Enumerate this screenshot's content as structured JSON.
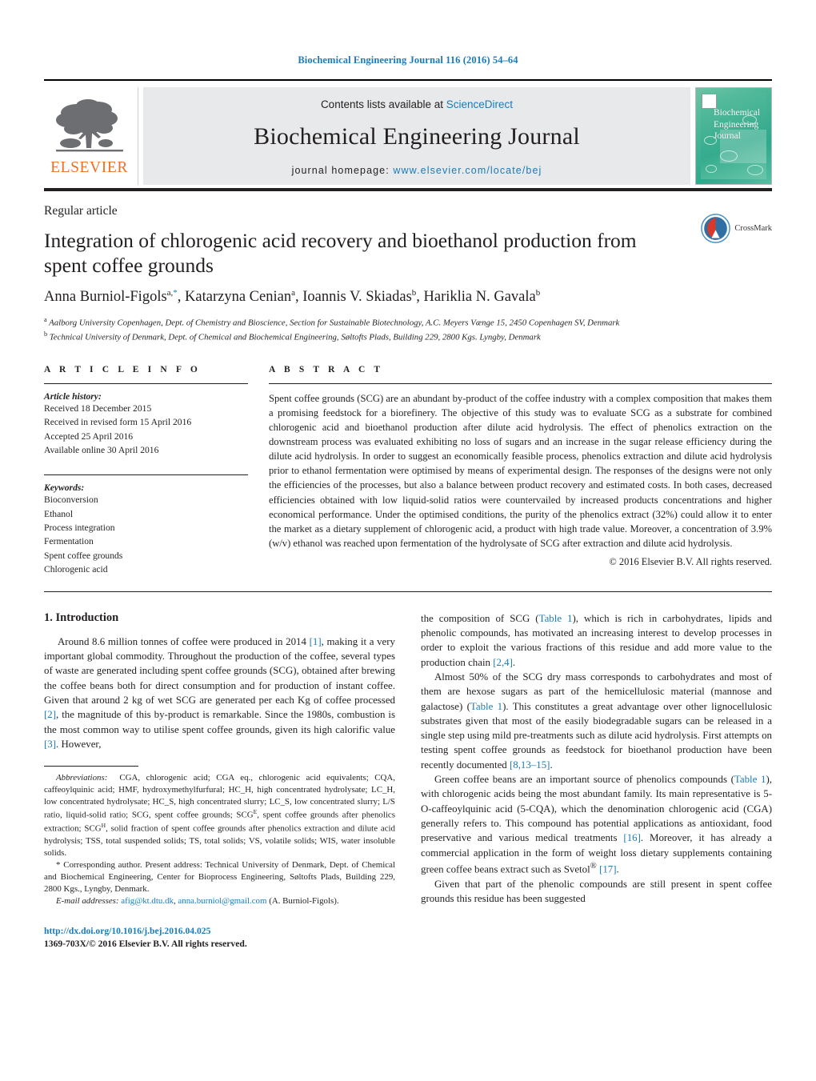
{
  "masthead": {
    "running_head": "Biochemical Engineering Journal 116 (2016) 54–64",
    "contents_prefix": "Contents lists available at ",
    "contents_link": "ScienceDirect",
    "journal_title": "Biochemical Engineering Journal",
    "homepage_prefix": "journal homepage: ",
    "homepage_url": "www.elsevier.com/locate/bej",
    "publisher_logo_text": "ELSEVIER",
    "cover_title_lines": [
      "Biochemical",
      "Engineering",
      "Journal"
    ],
    "link_color": "#1a7bb9",
    "publisher_color": "#ea7125"
  },
  "article": {
    "type": "Regular article",
    "title": "Integration of chlorogenic acid recovery and bioethanol production from spent coffee grounds",
    "crossmark_label": "CrossMark",
    "authors_html": "Anna Burniol-Figols<sup>a,<span class=\"star\">*</span></sup>, Katarzyna Cenian<sup>a</sup>, Ioannis V. Skiadas<sup>b</sup>, Hariklia N. Gavala<sup>b</sup>",
    "affiliations": [
      {
        "mark": "a",
        "text": "Aalborg University Copenhagen, Dept. of Chemistry and Bioscience, Section for Sustainable Biotechnology, A.C. Meyers Vænge 15, 2450 Copenhagen SV, Denmark"
      },
      {
        "mark": "b",
        "text": "Technical University of Denmark, Dept. of Chemical and Biochemical Engineering, Søltofts Plads, Building 229, 2800 Kgs. Lyngby, Denmark"
      }
    ]
  },
  "article_info": {
    "heading": "A R T I C L E   I N F O",
    "history_label": "Article history:",
    "history": [
      "Received 18 December 2015",
      "Received in revised form 15 April 2016",
      "Accepted 25 April 2016",
      "Available online 30 April 2016"
    ],
    "keywords_label": "Keywords:",
    "keywords": [
      "Bioconversion",
      "Ethanol",
      "Process integration",
      "Fermentation",
      "Spent coffee grounds",
      "Chlorogenic acid"
    ]
  },
  "abstract": {
    "heading": "A B S T R A C T",
    "text": "Spent coffee grounds (SCG) are an abundant by-product of the coffee industry with a complex composition that makes them a promising feedstock for a biorefinery. The objective of this study was to evaluate SCG as a substrate for combined chlorogenic acid and bioethanol production after dilute acid hydrolysis. The effect of phenolics extraction on the downstream process was evaluated exhibiting no loss of sugars and an increase in the sugar release efficiency during the dilute acid hydrolysis. In order to suggest an economically feasible process, phenolics extraction and dilute acid hydrolysis prior to ethanol fermentation were optimised by means of experimental design. The responses of the designs were not only the efficiencies of the processes, but also a balance between product recovery and estimated costs. In both cases, decreased efficiencies obtained with low liquid-solid ratios were countervailed by increased products concentrations and higher economical performance. Under the optimised conditions, the purity of the phenolics extract (32%) could allow it to enter the market as a dietary supplement of chlorogenic acid, a product with high trade value. Moreover, a concentration of 3.9% (w/v) ethanol was reached upon fermentation of the hydrolysate of SCG after extraction and dilute acid hydrolysis.",
    "copyright": "© 2016 Elsevier B.V. All rights reserved."
  },
  "introduction": {
    "heading": "1.  Introduction",
    "left_paragraphs": [
      "Around 8.6 million tonnes of coffee were produced in 2014 <span class=\"ref\">[1]</span>, making it a very important global commodity. Throughout the production of the coffee, several types of waste are generated including spent coffee grounds (SCG), obtained after brewing the coffee beans both for direct consumption and for production of instant coffee. Given that around 2 kg of wet SCG are generated per each Kg of coffee processed <span class=\"ref\">[2]</span>, the magnitude of this by-product is remarkable. Since the 1980s, combustion is the most common way to utilise spent coffee grounds, given its high calorific value <span class=\"ref\">[3]</span>. However,"
    ],
    "right_paragraphs": [
      "the composition of SCG (<span class=\"ref\">Table 1</span>), which is rich in carbohydrates, lipids and phenolic compounds, has motivated an increasing interest to develop processes in order to exploit the various fractions of this residue and add more value to the production chain <span class=\"ref\">[2,4]</span>.",
      "Almost 50% of the SCG dry mass corresponds to carbohydrates and most of them are hexose sugars as part of the hemicellulosic material (mannose and galactose) (<span class=\"ref\">Table 1</span>). This constitutes a great advantage over other lignocellulosic substrates given that most of the easily biodegradable sugars can be released in a single step using mild pre-treatments such as dilute acid hydrolysis. First attempts on testing spent coffee grounds as feedstock for bioethanol production have been recently documented <span class=\"ref\">[8,13–15]</span>.",
      "Green coffee beans are an important source of phenolics compounds (<span class=\"ref\">Table 1</span>), with chlorogenic acids being the most abundant family. Its main representative is 5-O-caffeoylquinic acid (5-CQA), which the denomination chlorogenic acid (CGA) generally refers to. This compound has potential applications as antioxidant, food preservative and various medical treatments <span class=\"ref\">[16]</span>. Moreover, it has already a commercial application in the form of weight loss dietary supplements containing green coffee beans extract such as Svetol<sup>®</sup> <span class=\"ref\">[17]</span>.",
      "Given that part of the phenolic compounds are still present in spent coffee grounds this residue has been suggested"
    ]
  },
  "footnotes": {
    "abbreviations_html": "<em>Abbreviations:</em>&nbsp; CGA, chlorogenic acid; CGA eq., chlorogenic acid equivalents; CQA, caffeoylquinic acid; HMF, hydroxymethylfurfural; HC_H, high concentrated hydrolysate; LC_H, low concentrated hydrolysate; HC_S, high concentrated slurry; LC_S, low concentrated slurry; L/S ratio, liquid-solid ratio; SCG, spent coffee grounds; SCG<sup>E</sup>, spent coffee grounds after phenolics extraction; SCG<sup>H</sup>, solid fraction of spent coffee grounds after phenolics extraction and dilute acid hydrolysis; TSS, total suspended solids; TS, total solids; VS, volatile solids; WIS, water insoluble solids.",
    "corresponding_html": "* Corresponding author. Present address: Technical University of Denmark, Dept. of Chemical and Biochemical Engineering, Center for Bioprocess Engineering, Søltofts Plads, Building 229, 2800 Kgs., Lyngby, Denmark.",
    "email_html": "<em>E-mail addresses:</em> <span class=\"lnk\">afig@kt.dtu.dk</span>, <span class=\"lnk\">anna.burniol@gmail.com</span> (A. Burniol-Figols)."
  },
  "doi": {
    "url": "http://dx.doi.org/10.1016/j.bej.2016.04.025",
    "issn_line": "1369-703X/© 2016 Elsevier B.V. All rights reserved."
  }
}
